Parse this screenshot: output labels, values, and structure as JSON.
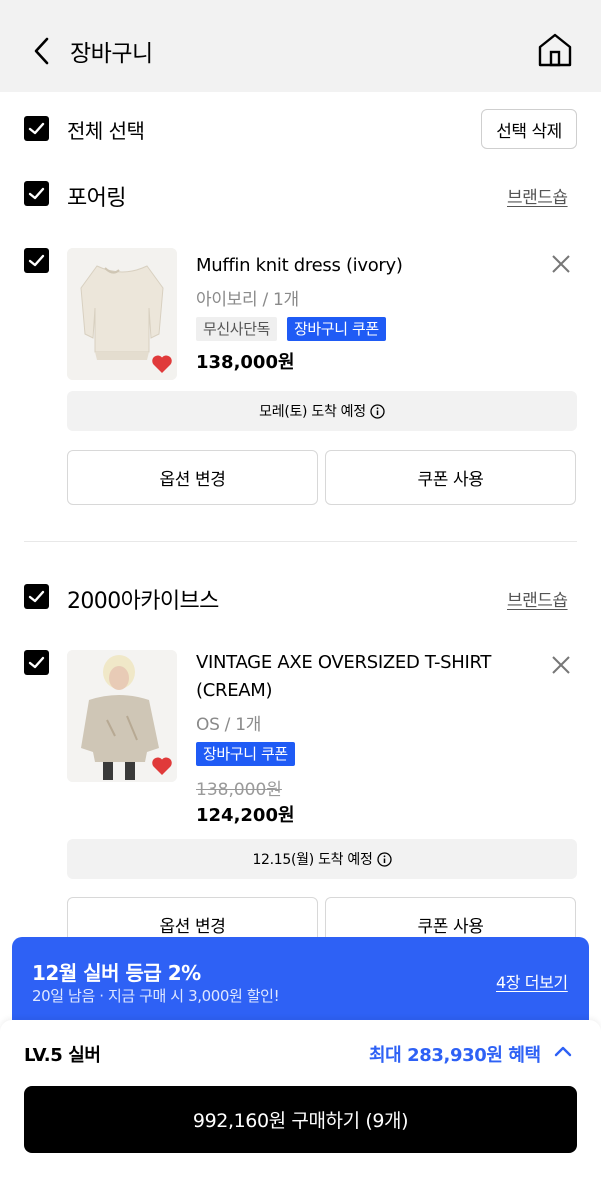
{
  "header": {
    "title": "장바구니"
  },
  "select_bar": {
    "select_all_label": "전체 선택",
    "delete_selected_label": "선택 삭제"
  },
  "brands": [
    {
      "name": "포어링",
      "shop_label": "브랜드숍",
      "item": {
        "name": "Muffin knit dress (ivory)",
        "option": "아이보리 / 1개",
        "badges": [
          "무신사단독",
          "장바구니 쿠폰"
        ],
        "original_price": "",
        "price": "138,000원",
        "delivery": "모레(토) 도착 예정",
        "option_change_label": "옵션 변경",
        "coupon_label": "쿠폰 사용"
      }
    },
    {
      "name": "2000아카이브스",
      "shop_label": "브랜드숍",
      "item": {
        "name": "VINTAGE AXE OVERSIZED T-SHIRT (CREAM)",
        "option": "OS / 1개",
        "badges": [
          "장바구니 쿠폰"
        ],
        "original_price": "138,000원",
        "price": "124,200원",
        "delivery": "12.15(월) 도착 예정",
        "option_change_label": "옵션 변경",
        "coupon_label": "쿠폰 사용"
      }
    }
  ],
  "promo": {
    "title": "12월 실버 등급 2%",
    "subtitle": "20일 남음 · 지금 구매 시 3,000원 할인!",
    "more_label": "4장 더보기"
  },
  "footer": {
    "level": "LV.5 실버",
    "max_benefit": "최대 283,930원 혜택",
    "buy_label": "992,160원 구매하기 (9개)"
  },
  "colors": {
    "accent": "#2e61f5",
    "heart": "#e03a3a",
    "checkbox": "#000000"
  }
}
